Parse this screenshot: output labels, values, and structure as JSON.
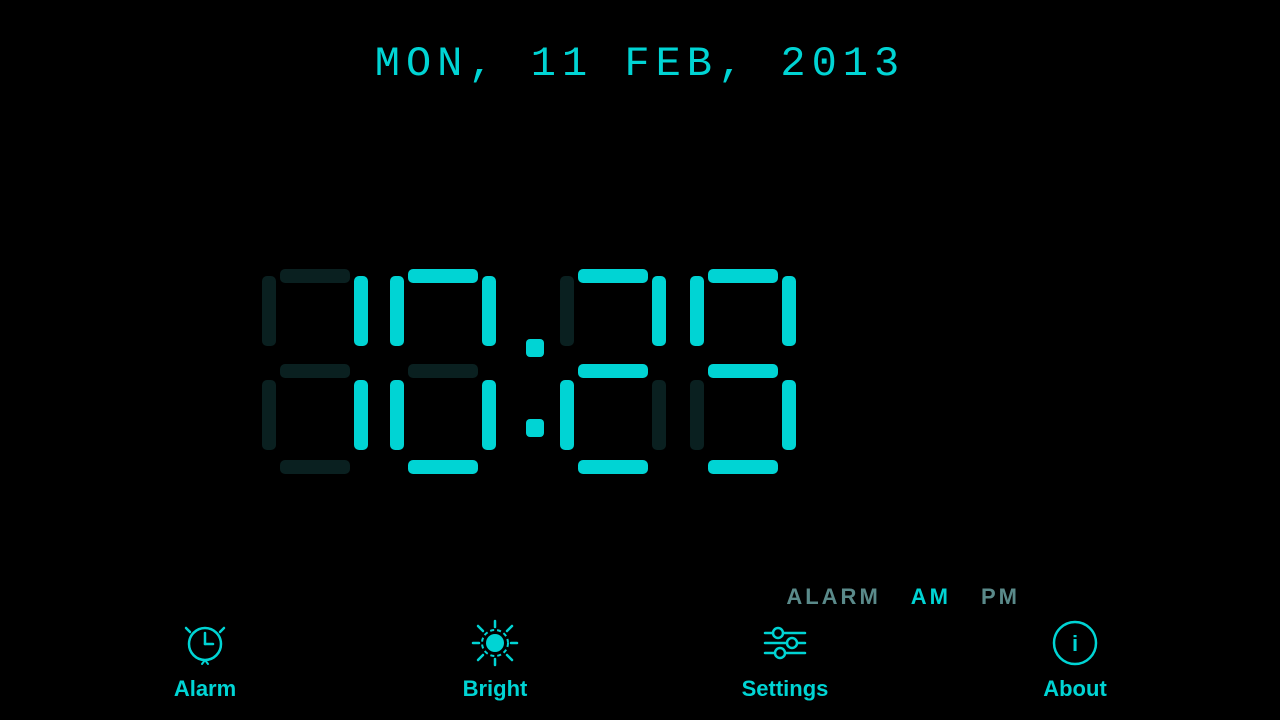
{
  "date": {
    "display": "MON,  11 FEB,  2013"
  },
  "clock": {
    "time": "10:29",
    "hours": "10",
    "minutes": "29",
    "hour1": "1",
    "hour2": "0",
    "min1": "2",
    "min2": "9"
  },
  "indicators": {
    "alarm_label": "ALARM",
    "am_label": "AM",
    "pm_label": "PM"
  },
  "nav": {
    "alarm": {
      "label": "Alarm"
    },
    "bright": {
      "label": "Bright"
    },
    "settings": {
      "label": "Settings"
    },
    "about": {
      "label": "About"
    }
  },
  "colors": {
    "primary": "#00d4d4",
    "dim": "#5a8a8a",
    "bg": "#000000"
  }
}
